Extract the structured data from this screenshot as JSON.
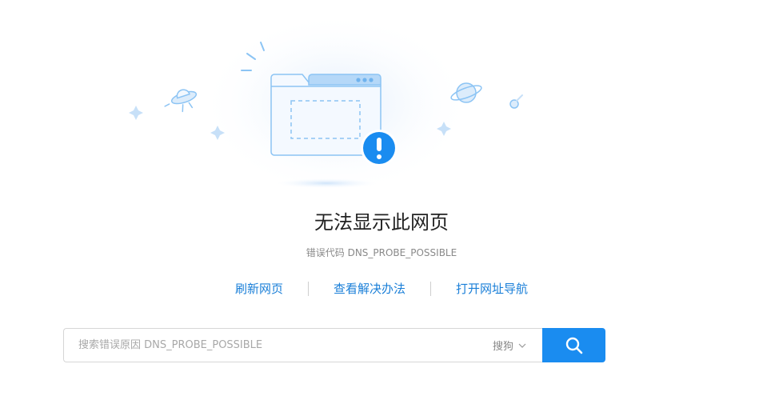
{
  "page": {
    "title": "无法显示此网页",
    "error_code": "错误代码 DNS_PROBE_POSSIBLE"
  },
  "actions": {
    "refresh": "刷新网页",
    "solutions": "查看解决办法",
    "navigation": "打开网址导航"
  },
  "search": {
    "placeholder": "搜索错误原因 DNS_PROBE_POSSIBLE",
    "engine": "搜狗",
    "engine_icon": "chevron-down-icon",
    "button_icon": "search-icon"
  },
  "illustration": {
    "alert_symbol": "!"
  },
  "colors": {
    "accent": "#1a8cf0",
    "link": "#1a7fd8",
    "illustration_light": "#e3f0fd",
    "illustration_mid": "#8cc4f4"
  }
}
